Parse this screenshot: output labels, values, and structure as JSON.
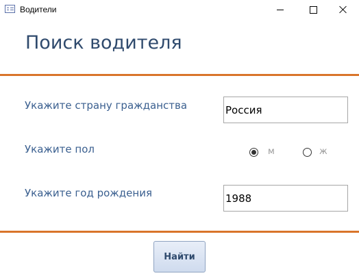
{
  "window": {
    "title": "Водители",
    "icon": "form-icon",
    "controls": [
      "minimize-icon",
      "maximize-icon",
      "close-icon"
    ]
  },
  "form": {
    "heading": "Поиск водителя",
    "accent_color": "#d9752a",
    "heading_color": "#2f4a6d",
    "label_color": "#3a5f8f"
  },
  "fields": {
    "country": {
      "label": "Укажите страну гражданства",
      "value": "Россия"
    },
    "gender": {
      "label": "Укажите пол",
      "options": [
        {
          "label": "м",
          "selected": true
        },
        {
          "label": "ж",
          "selected": false
        }
      ]
    },
    "birth_year": {
      "label": "Укажите год рождения",
      "value": "1988"
    }
  },
  "actions": {
    "find_label": "Найти"
  }
}
